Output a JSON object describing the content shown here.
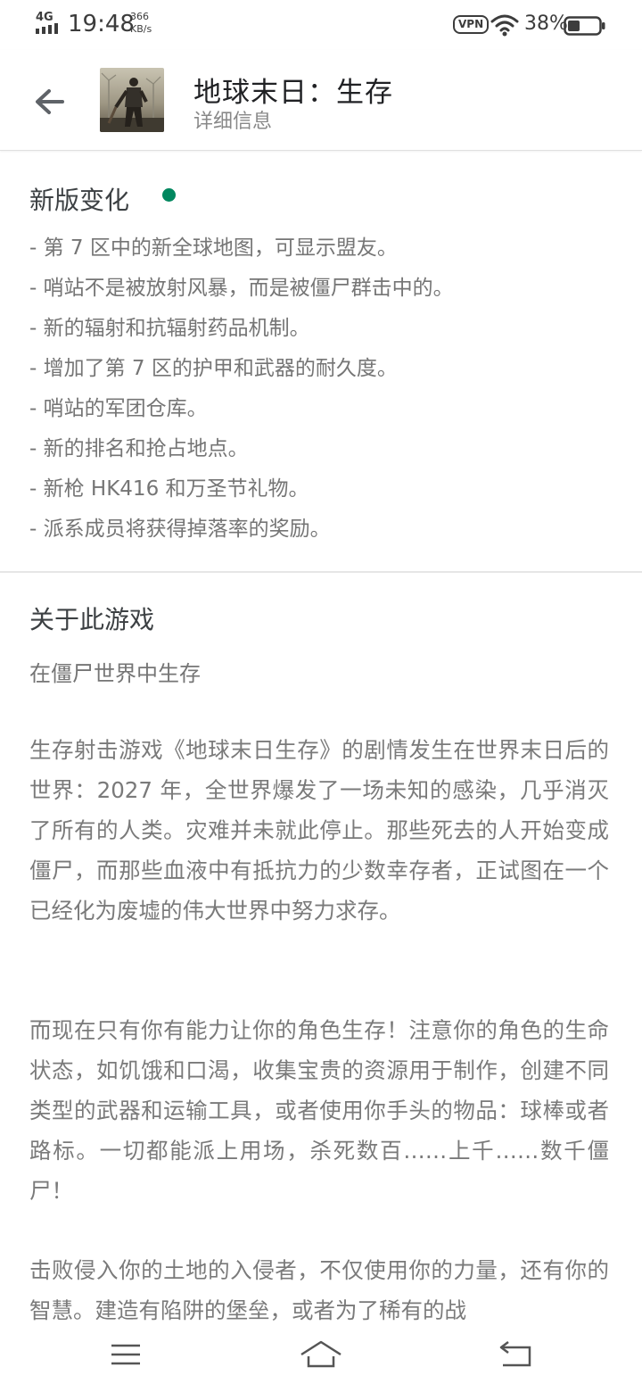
{
  "status_bar": {
    "network": "4G",
    "time": "19:48",
    "speed_value": "366",
    "speed_unit": "KB/s",
    "vpn": "VPN",
    "battery": "38%"
  },
  "app_bar": {
    "title": "地球末日：生存",
    "subtitle": "详细信息",
    "thumbnail_icon": "app-thumbnail"
  },
  "whats_new": {
    "title": "新版变化",
    "dot_color": "#01875f",
    "items": [
      "- 第 7 区中的新全球地图，可显示盟友。",
      "- 哨站不是被放射风暴，而是被僵尸群击中的。",
      "- 新的辐射和抗辐射药品机制。",
      "- 增加了第 7 区的护甲和武器的耐久度。",
      "- 哨站的军团仓库。",
      "- 新的排名和抢占地点。",
      "- 新枪 HK416 和万圣节礼物。",
      "- 派系成员将获得掉落率的奖励。"
    ]
  },
  "about": {
    "title": "关于此游戏",
    "tagline": "在僵尸世界中生存",
    "paragraphs": [
      "生存射击游戏《地球末日生存》的剧情发生在世界末日后的世界：2027 年，全世界爆发了一场未知的感染，几乎消灭了所有的人类。灾难并未就此停止。那些死去的人开始变成僵尸，而那些血液中有抵抗力的少数幸存者，正试图在一个已经化为废墟的伟大世界中努力求存。",
      "而现在只有你有能力让你的角色生存！注意你的角色的生命状态，如饥饿和口渴，收集宝贵的资源用于制作，创建不同类型的武器和运输工具，或者使用你手头的物品：球棒或者路标。一切都能派上用场，杀死数百……上千……数千僵尸！",
      "击败侵入你的土地的入侵者，不仅使用你的力量，还有你的智慧。建造有陷阱的堡垒，或者为了稀有的战"
    ]
  },
  "nav_bar": {
    "menu_icon": "menu-icon",
    "home_icon": "home-icon",
    "back_icon": "back-icon"
  }
}
